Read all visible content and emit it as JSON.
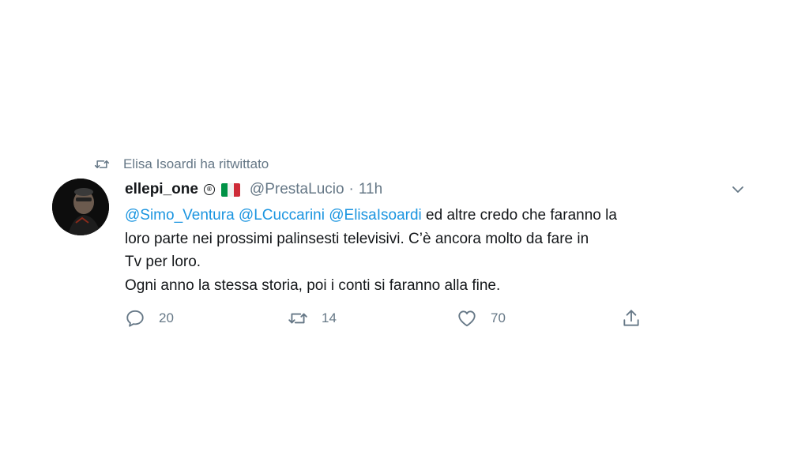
{
  "retweet_context": {
    "icon": "retweet-icon",
    "text": "Elisa Isoardi ha ritwittato"
  },
  "author": {
    "display_name": "ellepi_one",
    "badge": "®",
    "flag": "italy-flag-icon",
    "handle": "@PrestaLucio",
    "separator": "·",
    "time": "11h"
  },
  "body": {
    "mentions": [
      "@Simo_Ventura",
      "@LCuccarini",
      "@ElisaIsoardi"
    ],
    "text_line1_rest": " ed altre credo che faranno la",
    "text_line2": "loro parte nei prossimi palinsesti televisivi. C’è ancora molto da fare in",
    "text_line3": "Tv per loro.",
    "text_line4": "Ogni anno la stessa storia, poi i conti si faranno alla fine."
  },
  "actions": {
    "reply_count": "20",
    "retweet_count": "14",
    "like_count": "70"
  },
  "colors": {
    "link": "#1b95e0",
    "secondary_text": "#657786",
    "primary_text": "#14171a"
  }
}
